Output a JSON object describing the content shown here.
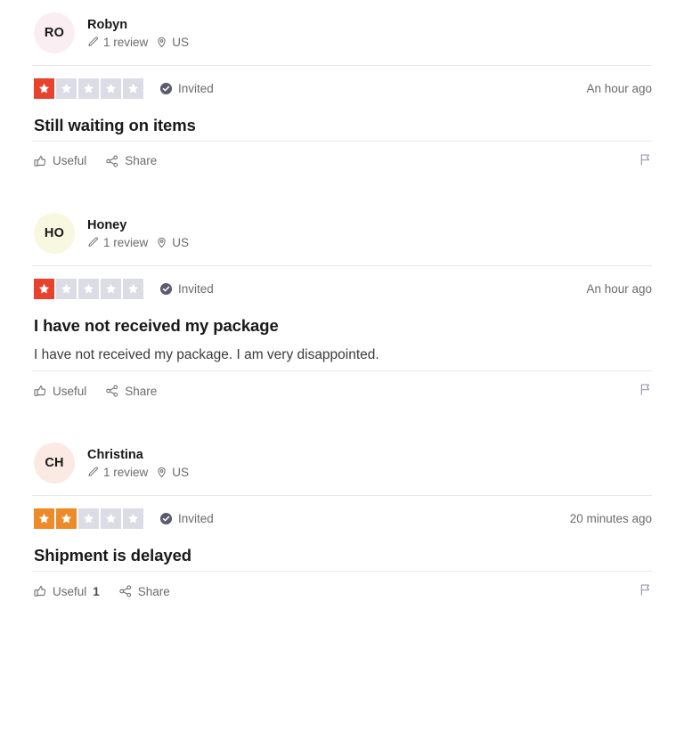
{
  "page": {
    "colors": {
      "star_filled_1": "#e8412c",
      "star_filled_2": "#ee8b28",
      "star_empty": "#dcdce6",
      "badge_circle": "#5b5b6e",
      "text_primary": "#191919",
      "text_muted": "#6b6b6b",
      "divider": "#e8e8ea",
      "background": "#ffffff"
    }
  },
  "labels": {
    "invited": "Invited",
    "useful": "Useful",
    "share": "Share",
    "review_count_suffix": "review",
    "pencil_icon": "pencil-icon",
    "location_icon": "location-pin-icon",
    "verified_icon": "verified-check-icon",
    "thumbs_up_icon": "thumbs-up-icon",
    "share_icon": "share-nodes-icon",
    "flag_icon": "flag-report-icon",
    "star_icon": "star-icon"
  },
  "reviews": [
    {
      "id": "review-robyn",
      "avatar": {
        "initials": "RO",
        "color": "#fbeef3"
      },
      "consumer": {
        "name": "Robyn",
        "reviews": "1 review",
        "country": "US"
      },
      "rating": {
        "value": 1,
        "max": 5,
        "fill_class": "filled-1"
      },
      "invited": "Invited",
      "timestamp": "An hour ago",
      "title": "Still waiting on items",
      "body": "",
      "actions": {
        "useful": "Useful",
        "useful_count": "",
        "share": "Share"
      }
    },
    {
      "id": "review-honey",
      "avatar": {
        "initials": "HO",
        "color": "#f8f8e0"
      },
      "consumer": {
        "name": "Honey",
        "reviews": "1 review",
        "country": "US"
      },
      "rating": {
        "value": 1,
        "max": 5,
        "fill_class": "filled-1"
      },
      "invited": "Invited",
      "timestamp": "An hour ago",
      "title": "I have not received my package",
      "body": "I have not received my package. I am very disappointed.",
      "actions": {
        "useful": "Useful",
        "useful_count": "",
        "share": "Share"
      }
    },
    {
      "id": "review-christina",
      "avatar": {
        "initials": "CH",
        "color": "#fbeae4"
      },
      "consumer": {
        "name": "Christina",
        "reviews": "1 review",
        "country": "US"
      },
      "rating": {
        "value": 2,
        "max": 5,
        "fill_class": "filled-2"
      },
      "invited": "Invited",
      "timestamp": "20 minutes ago",
      "title": "Shipment is delayed",
      "body": "",
      "actions": {
        "useful": "Useful",
        "useful_count": "1",
        "share": "Share"
      }
    }
  ]
}
